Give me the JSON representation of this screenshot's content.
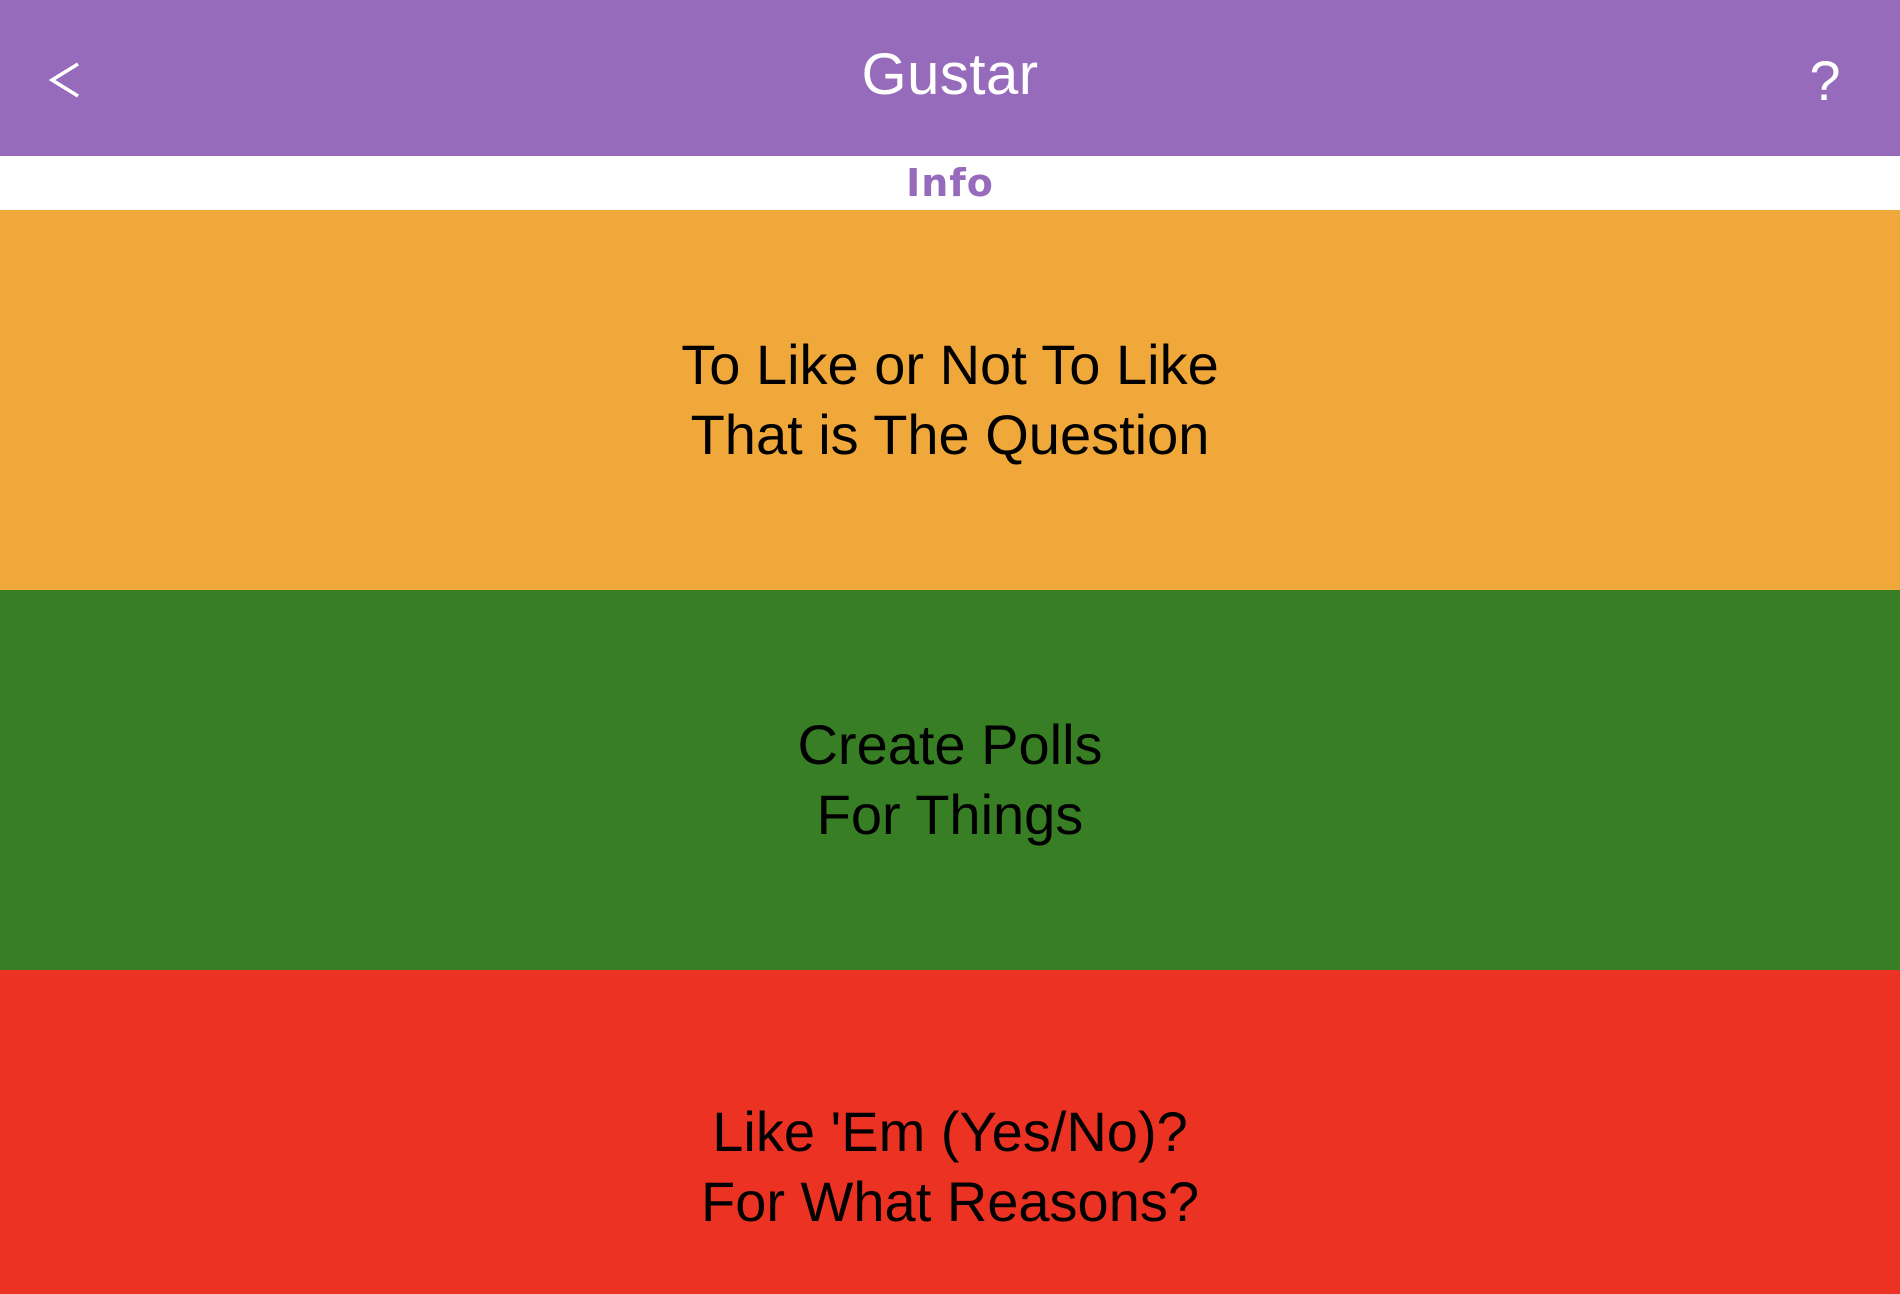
{
  "header": {
    "title": "Gustar",
    "back_label": "<",
    "help_label": "?",
    "background": "#976bbb",
    "text_color": "#ffffff"
  },
  "subheader": {
    "label": "Info",
    "color": "#976bbb"
  },
  "panels": [
    {
      "line1": "To Like or Not To Like",
      "line2": "That is The Question",
      "background": "#f1a83b"
    },
    {
      "line1": "Create Polls",
      "line2": "For Things",
      "background": "#387e24"
    },
    {
      "line1": "Like 'Em (Yes/No)?",
      "line2": "For What Reasons?",
      "background": "#ec3223"
    }
  ]
}
